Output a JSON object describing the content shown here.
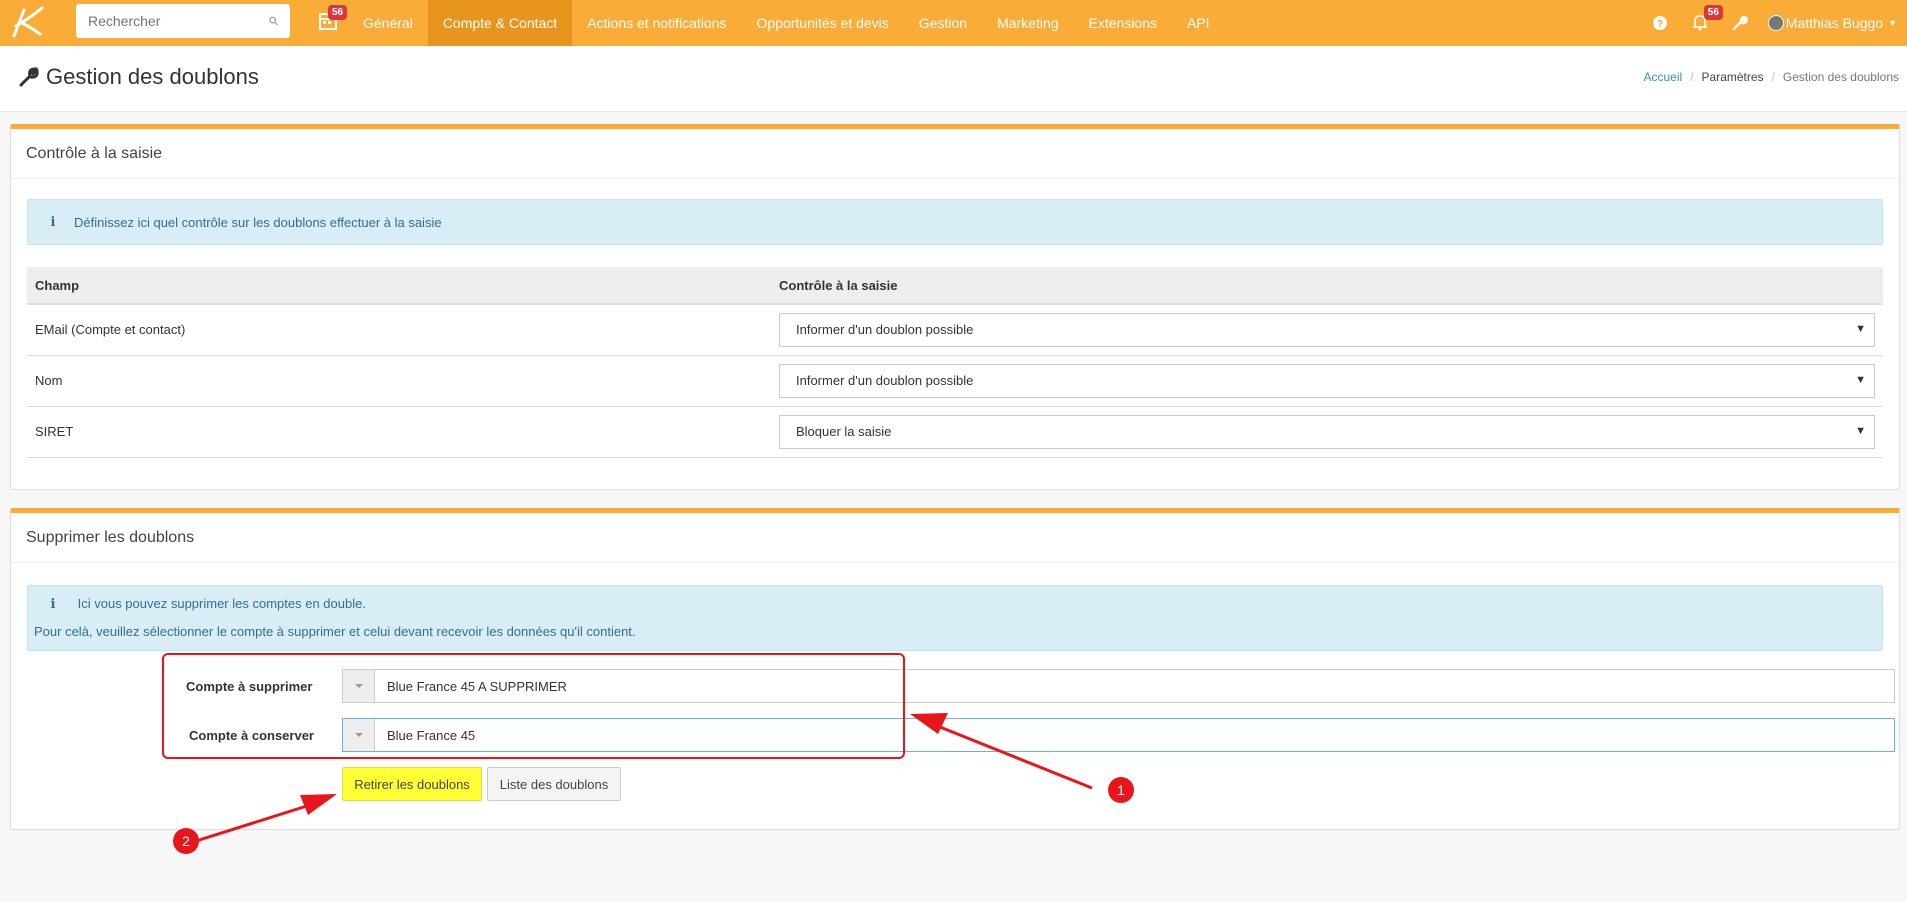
{
  "navbar": {
    "search_placeholder": "Rechercher",
    "calendar_badge": "56",
    "items": [
      {
        "label": "Général"
      },
      {
        "label": "Compte & Contact",
        "active": true
      },
      {
        "label": "Actions et notifications"
      },
      {
        "label": "Opportunités et devis"
      },
      {
        "label": "Gestion"
      },
      {
        "label": "Marketing"
      },
      {
        "label": "Extensions"
      },
      {
        "label": "API"
      }
    ],
    "notif_badge": "56",
    "user_name": "Matthias Buggo",
    "icons": [
      "help-icon",
      "bell-icon",
      "wrench-icon",
      "user-avatar"
    ]
  },
  "header": {
    "title": "Gestion des doublons",
    "breadcrumb": [
      "Accueil",
      "Paramètres",
      "Gestion des doublons"
    ]
  },
  "panel1": {
    "title": "Contrôle à la saisie",
    "alert": "Définissez ici quel contrôle sur les doublons effectuer à la saisie",
    "columns": [
      "Champ",
      "Contrôle à la saisie"
    ],
    "rows": [
      {
        "field": "EMail (Compte et contact)",
        "value": "Informer d'un doublon possible"
      },
      {
        "field": "Nom",
        "value": "Informer d'un doublon possible"
      },
      {
        "field": "SIRET",
        "value": "Bloquer la saisie"
      }
    ]
  },
  "panel2": {
    "title": "Supprimer les doublons",
    "alert_line1": "Ici vous pouvez supprimer les comptes en double.",
    "alert_line2": "Pour celà, veuillez sélectionner le compte à supprimer et celui devant recevoir les données qu'il contient.",
    "label_delete": "Compte à supprimer",
    "value_delete": "Blue France 45 A SUPPRIMER",
    "label_keep": "Compte à conserver",
    "value_keep": "Blue France 45",
    "btn_remove": "Retirer les doublons",
    "btn_list": "Liste des doublons"
  },
  "annotations": {
    "marker1": "1",
    "marker2": "2",
    "color": "#e8161b"
  }
}
